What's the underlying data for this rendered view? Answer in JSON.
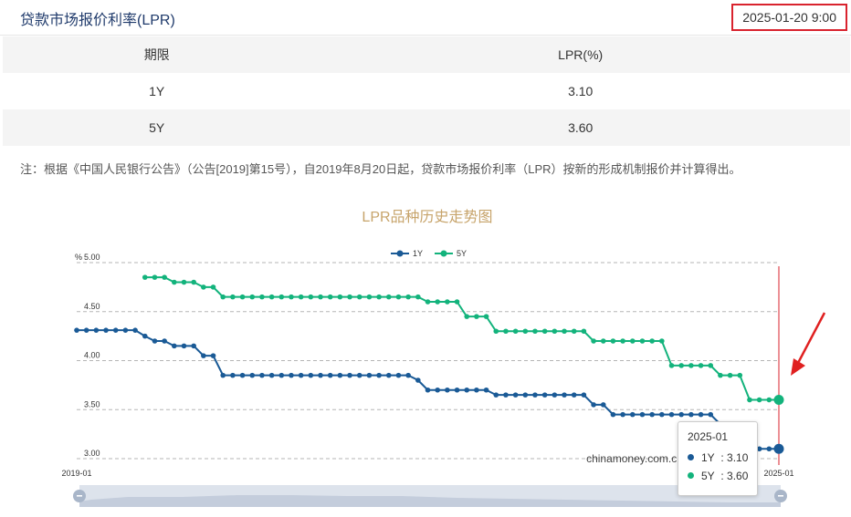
{
  "header": {
    "title": "贷款市场报价利率(LPR)",
    "timestamp": "2025-01-20 9:00",
    "timestamp_highlight_color": "#d9232e"
  },
  "table": {
    "headers": [
      "期限",
      "LPR(%)"
    ],
    "rows": [
      {
        "term": "1Y",
        "rate": "3.10"
      },
      {
        "term": "5Y",
        "rate": "3.60"
      }
    ]
  },
  "note": "注：根据《中国人民银行公告》（公告[2019]第15号），自2019年8月20日起，贷款市场报价利率（LPR）按新的形成机制报价并计算得出。",
  "chart_data": {
    "type": "line",
    "title": "LPR品种历史走势图",
    "ylabel": "%",
    "xlabel": "",
    "x_tick_labels": [
      "2019-01",
      "2025-01"
    ],
    "y_ticks": [
      "5.00",
      "4.50",
      "4.00",
      "3.50",
      "3.00"
    ],
    "ylim": [
      3.0,
      5.0
    ],
    "x_range": [
      "2019-01",
      "2025-01"
    ],
    "grid": true,
    "legend_position": "top-center",
    "watermark": "chinamoney.com.cn",
    "colors": {
      "1Y": "#1a5a96",
      "5Y": "#13b37c",
      "title": "#c7a46b",
      "marker_line": "#d9232e"
    },
    "series": [
      {
        "name": "1Y",
        "values": [
          [
            "2019-01",
            4.31
          ],
          [
            "2019-02",
            4.31
          ],
          [
            "2019-03",
            4.31
          ],
          [
            "2019-04",
            4.31
          ],
          [
            "2019-05",
            4.31
          ],
          [
            "2019-06",
            4.31
          ],
          [
            "2019-07",
            4.31
          ],
          [
            "2019-08",
            4.25
          ],
          [
            "2019-09",
            4.2
          ],
          [
            "2019-10",
            4.2
          ],
          [
            "2019-11",
            4.15
          ],
          [
            "2019-12",
            4.15
          ],
          [
            "2020-01",
            4.15
          ],
          [
            "2020-02",
            4.05
          ],
          [
            "2020-03",
            4.05
          ],
          [
            "2020-04",
            3.85
          ],
          [
            "2020-05",
            3.85
          ],
          [
            "2020-06",
            3.85
          ],
          [
            "2020-07",
            3.85
          ],
          [
            "2020-08",
            3.85
          ],
          [
            "2020-09",
            3.85
          ],
          [
            "2020-10",
            3.85
          ],
          [
            "2020-11",
            3.85
          ],
          [
            "2020-12",
            3.85
          ],
          [
            "2021-01",
            3.85
          ],
          [
            "2021-02",
            3.85
          ],
          [
            "2021-03",
            3.85
          ],
          [
            "2021-04",
            3.85
          ],
          [
            "2021-05",
            3.85
          ],
          [
            "2021-06",
            3.85
          ],
          [
            "2021-07",
            3.85
          ],
          [
            "2021-08",
            3.85
          ],
          [
            "2021-09",
            3.85
          ],
          [
            "2021-10",
            3.85
          ],
          [
            "2021-11",
            3.85
          ],
          [
            "2021-12",
            3.8
          ],
          [
            "2022-01",
            3.7
          ],
          [
            "2022-02",
            3.7
          ],
          [
            "2022-03",
            3.7
          ],
          [
            "2022-04",
            3.7
          ],
          [
            "2022-05",
            3.7
          ],
          [
            "2022-06",
            3.7
          ],
          [
            "2022-07",
            3.7
          ],
          [
            "2022-08",
            3.65
          ],
          [
            "2022-09",
            3.65
          ],
          [
            "2022-10",
            3.65
          ],
          [
            "2022-11",
            3.65
          ],
          [
            "2022-12",
            3.65
          ],
          [
            "2023-01",
            3.65
          ],
          [
            "2023-02",
            3.65
          ],
          [
            "2023-03",
            3.65
          ],
          [
            "2023-04",
            3.65
          ],
          [
            "2023-05",
            3.65
          ],
          [
            "2023-06",
            3.55
          ],
          [
            "2023-07",
            3.55
          ],
          [
            "2023-08",
            3.45
          ],
          [
            "2023-09",
            3.45
          ],
          [
            "2023-10",
            3.45
          ],
          [
            "2023-11",
            3.45
          ],
          [
            "2023-12",
            3.45
          ],
          [
            "2024-01",
            3.45
          ],
          [
            "2024-02",
            3.45
          ],
          [
            "2024-03",
            3.45
          ],
          [
            "2024-04",
            3.45
          ],
          [
            "2024-05",
            3.45
          ],
          [
            "2024-06",
            3.45
          ],
          [
            "2024-07",
            3.35
          ],
          [
            "2024-08",
            3.35
          ],
          [
            "2024-09",
            3.35
          ],
          [
            "2024-10",
            3.1
          ],
          [
            "2024-11",
            3.1
          ],
          [
            "2024-12",
            3.1
          ],
          [
            "2025-01",
            3.1
          ]
        ]
      },
      {
        "name": "5Y",
        "values": [
          [
            "2019-08",
            4.85
          ],
          [
            "2019-09",
            4.85
          ],
          [
            "2019-10",
            4.85
          ],
          [
            "2019-11",
            4.8
          ],
          [
            "2019-12",
            4.8
          ],
          [
            "2020-01",
            4.8
          ],
          [
            "2020-02",
            4.75
          ],
          [
            "2020-03",
            4.75
          ],
          [
            "2020-04",
            4.65
          ],
          [
            "2020-05",
            4.65
          ],
          [
            "2020-06",
            4.65
          ],
          [
            "2020-07",
            4.65
          ],
          [
            "2020-08",
            4.65
          ],
          [
            "2020-09",
            4.65
          ],
          [
            "2020-10",
            4.65
          ],
          [
            "2020-11",
            4.65
          ],
          [
            "2020-12",
            4.65
          ],
          [
            "2021-01",
            4.65
          ],
          [
            "2021-02",
            4.65
          ],
          [
            "2021-03",
            4.65
          ],
          [
            "2021-04",
            4.65
          ],
          [
            "2021-05",
            4.65
          ],
          [
            "2021-06",
            4.65
          ],
          [
            "2021-07",
            4.65
          ],
          [
            "2021-08",
            4.65
          ],
          [
            "2021-09",
            4.65
          ],
          [
            "2021-10",
            4.65
          ],
          [
            "2021-11",
            4.65
          ],
          [
            "2021-12",
            4.65
          ],
          [
            "2022-01",
            4.6
          ],
          [
            "2022-02",
            4.6
          ],
          [
            "2022-03",
            4.6
          ],
          [
            "2022-04",
            4.6
          ],
          [
            "2022-05",
            4.45
          ],
          [
            "2022-06",
            4.45
          ],
          [
            "2022-07",
            4.45
          ],
          [
            "2022-08",
            4.3
          ],
          [
            "2022-09",
            4.3
          ],
          [
            "2022-10",
            4.3
          ],
          [
            "2022-11",
            4.3
          ],
          [
            "2022-12",
            4.3
          ],
          [
            "2023-01",
            4.3
          ],
          [
            "2023-02",
            4.3
          ],
          [
            "2023-03",
            4.3
          ],
          [
            "2023-04",
            4.3
          ],
          [
            "2023-05",
            4.3
          ],
          [
            "2023-06",
            4.2
          ],
          [
            "2023-07",
            4.2
          ],
          [
            "2023-08",
            4.2
          ],
          [
            "2023-09",
            4.2
          ],
          [
            "2023-10",
            4.2
          ],
          [
            "2023-11",
            4.2
          ],
          [
            "2023-12",
            4.2
          ],
          [
            "2024-01",
            4.2
          ],
          [
            "2024-02",
            3.95
          ],
          [
            "2024-03",
            3.95
          ],
          [
            "2024-04",
            3.95
          ],
          [
            "2024-05",
            3.95
          ],
          [
            "2024-06",
            3.95
          ],
          [
            "2024-07",
            3.85
          ],
          [
            "2024-08",
            3.85
          ],
          [
            "2024-09",
            3.85
          ],
          [
            "2024-10",
            3.6
          ],
          [
            "2024-11",
            3.6
          ],
          [
            "2024-12",
            3.6
          ],
          [
            "2025-01",
            3.6
          ]
        ]
      }
    ],
    "tooltip": {
      "title": "2025-01",
      "rows": [
        {
          "name": "1Y",
          "sep": ":",
          "value": "3.10"
        },
        {
          "name": "5Y",
          "sep": ":",
          "value": "3.60"
        }
      ]
    }
  }
}
